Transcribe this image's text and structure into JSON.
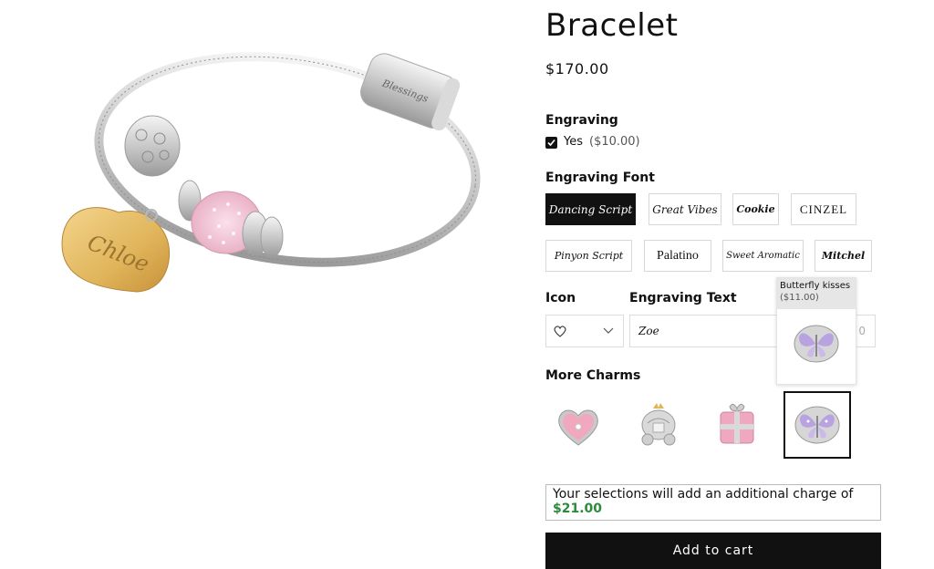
{
  "product": {
    "title": "Bracelet",
    "price": "$170.00",
    "pendant_text": "Chloe",
    "clasp_text": "Blessings"
  },
  "engraving": {
    "label": "Engraving",
    "option_label": "Yes",
    "option_price": "($10.00)",
    "checked": true
  },
  "engraving_font": {
    "label": "Engraving Font",
    "options": [
      {
        "label": "Dancing Script",
        "selected": true
      },
      {
        "label": "Great Vibes",
        "selected": false
      },
      {
        "label": "Cookie",
        "selected": false
      },
      {
        "label": "CINZEL",
        "selected": false
      },
      {
        "label": "Pinyon Script",
        "selected": false
      },
      {
        "label": "Palatino",
        "selected": false
      },
      {
        "label": "Sweet Aromatic",
        "selected": false
      },
      {
        "label": "Mitchel",
        "selected": false
      }
    ]
  },
  "icon": {
    "label": "Icon",
    "selected": "heart-icon"
  },
  "engraving_text": {
    "label": "Engraving Text",
    "value": "Zoe",
    "char_count": "0"
  },
  "charms": {
    "label": "More Charms",
    "items": [
      {
        "name": "pink-heart-charm",
        "selected": false
      },
      {
        "name": "crown-carriage-charm",
        "selected": false
      },
      {
        "name": "pink-gift-charm",
        "selected": false
      },
      {
        "name": "butterfly-charm",
        "selected": true
      }
    ],
    "tooltip": {
      "name": "Butterfly kisses",
      "price": "($11.00)"
    }
  },
  "notice": {
    "text": "Your selections will add an additional charge of",
    "amount": "$21.00"
  },
  "cart": {
    "button_label": "Add to cart"
  },
  "colors": {
    "accent": "#111111",
    "charge_green": "#2c8a3b",
    "gold": "#e0b45a",
    "pink": "#f0a8bf",
    "lavender": "#b9a2e0"
  }
}
